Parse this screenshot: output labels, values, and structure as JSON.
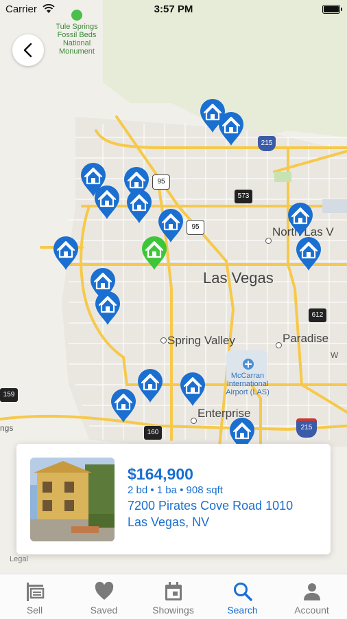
{
  "status_bar": {
    "carrier": "Carrier",
    "time": "3:57 PM"
  },
  "map": {
    "labels": {
      "landmark": "Tule Springs\nFossil Beds\nNational\nMonument",
      "las_vegas": "Las Vegas",
      "north_las_vegas": "North Las V",
      "spring_valley": "Spring Valley",
      "paradise": "Paradise",
      "airport": "McCarran\nInternational\nAirport (LAS)",
      "enterprise": "Enterprise",
      "edge_left": "ngs",
      "edge_right": "W"
    },
    "shields": [
      "215",
      "95",
      "95",
      "573",
      "612",
      "159",
      "160",
      "215"
    ],
    "legal": "Legal"
  },
  "listing": {
    "price": "$164,900",
    "details": "2 bd • 1 ba • 908 sqft",
    "address_line1": "7200 Pirates Cove Road 1010",
    "address_line2": "Las Vegas, NV"
  },
  "tabs": [
    {
      "label": "Sell",
      "icon": "sign-icon"
    },
    {
      "label": "Saved",
      "icon": "heart-icon"
    },
    {
      "label": "Showings",
      "icon": "calendar-icon"
    },
    {
      "label": "Search",
      "icon": "search-icon"
    },
    {
      "label": "Account",
      "icon": "person-icon"
    }
  ],
  "colors": {
    "accent": "#1a6fd0",
    "pin_selected": "#3ec63a",
    "pin": "#1a6fd0",
    "road": "#f6c94a"
  }
}
